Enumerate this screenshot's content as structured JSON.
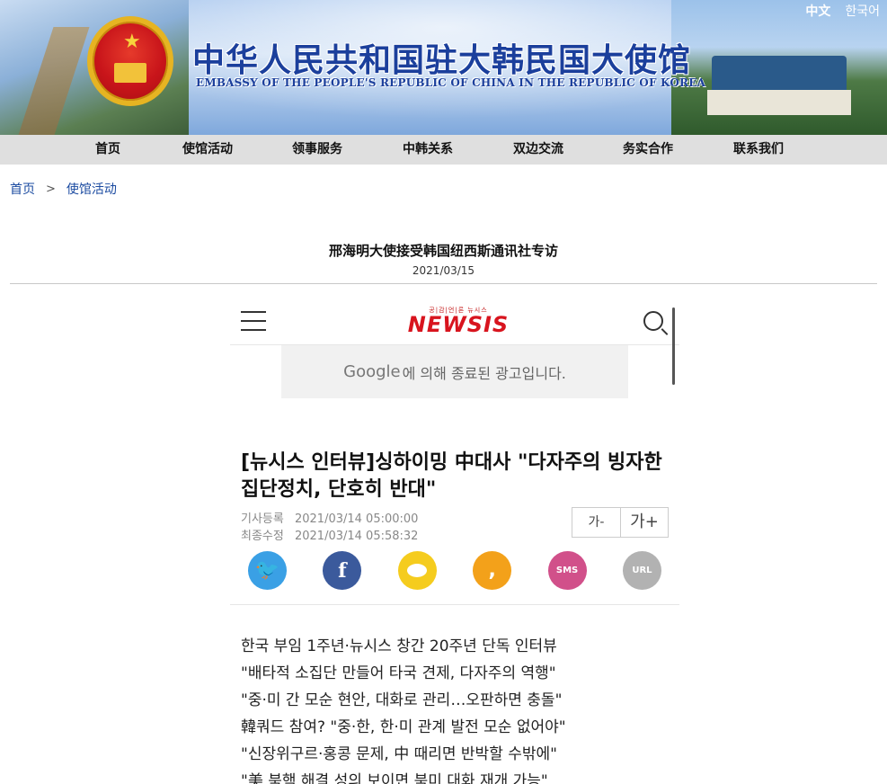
{
  "header": {
    "title_cn": "中华人民共和国驻大韩民国大使馆",
    "title_en": "EMBASSY OF THE PEOPLE'S REPUBLIC OF CHINA IN THE REPUBLIC OF KOREA",
    "lang": [
      "中文",
      "한국어"
    ]
  },
  "nav": [
    "首页",
    "使馆活动",
    "领事服务",
    "中韩关系",
    "双边交流",
    "务实合作",
    "联系我们"
  ],
  "breadcrumb": {
    "home": "首页",
    "sep": ">",
    "current": "使馆活动"
  },
  "article": {
    "title": "邢海明大使接受韩国纽西斯通讯社专访",
    "date": "2021/03/15"
  },
  "newsis": {
    "logo_small": "공|감|언|론 뉴시스",
    "logo": "NEWSIS",
    "ad_google": "Google",
    "ad_text": "에 의해 종료된 광고입니다.",
    "headline": "[뉴시스 인터뷰]싱하이밍 中대사 \"다자주의 빙자한 집단정치, 단호히 반대\"",
    "registered_label": "기사등록",
    "registered": "2021/03/14  05:00:00",
    "modified_label": "최종수정",
    "modified": "2021/03/14  05:58:32",
    "font_minus": "가-",
    "font_plus": "가+",
    "share_sms": "SMS",
    "share_url": "URL",
    "summary": [
      "한국 부임 1주년·뉴시스 창간 20주년 단독 인터뷰",
      "\"배타적 소집단 만들어 타국 견제, 다자주의 역행\"",
      "\"중·미 간 모순 현안, 대화로 관리…오판하면 충돌\"",
      "韓쿼드 참여? \"중·한, 한·미 관계 발전 모순 없어야\"",
      "\"신장위구르·홍콩 문제, 中 때리면 반박할 수밖에\"",
      "\"美 북핵 해결 성의 보이면 북미 대화 재개 가능\""
    ]
  },
  "colors": {
    "title_blue": "#1b3f9c",
    "nav_bg": "#dfdfdf",
    "link_blue": "#1a4aa0",
    "newsis_red": "#d8141e"
  }
}
